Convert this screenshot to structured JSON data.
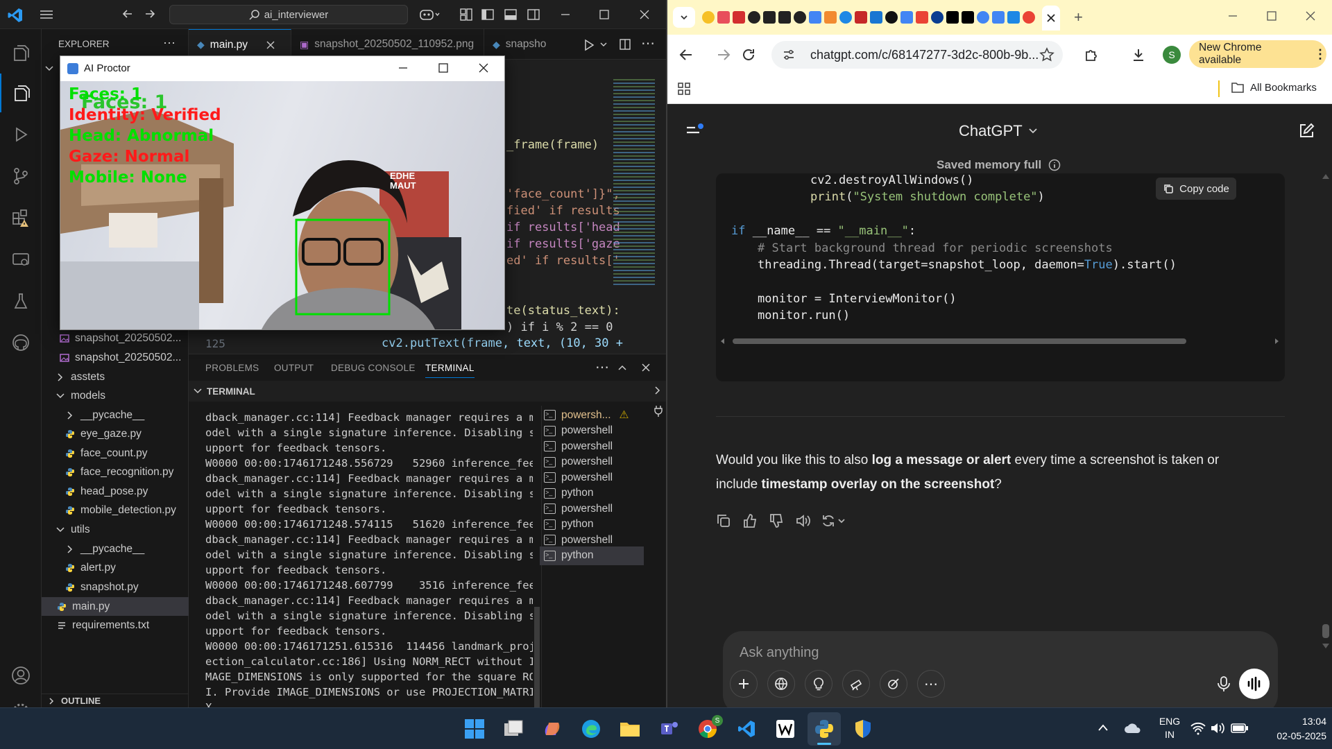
{
  "vscode": {
    "search_text": "ai_interviewer",
    "explorer_title": "EXPLORER",
    "tabs": [
      {
        "label": "main.py"
      },
      {
        "label": "snapshot_20250502_110952.png"
      },
      {
        "label": "snapsho"
      }
    ],
    "tree": [
      {
        "label": "snapshot_20250502...",
        "kind": "image"
      },
      {
        "label": "snapshot_20250502...",
        "kind": "image"
      },
      {
        "label": "asstets",
        "kind": "folder"
      },
      {
        "label": "models",
        "kind": "folder-open"
      },
      {
        "label": "__pycache__",
        "kind": "folder"
      },
      {
        "label": "eye_gaze.py",
        "kind": "py"
      },
      {
        "label": "face_count.py",
        "kind": "py"
      },
      {
        "label": "face_recognition.py",
        "kind": "py"
      },
      {
        "label": "head_pose.py",
        "kind": "py"
      },
      {
        "label": "mobile_detection.py",
        "kind": "py"
      },
      {
        "label": "utils",
        "kind": "folder-open"
      },
      {
        "label": "__pycache__",
        "kind": "folder"
      },
      {
        "label": "alert.py",
        "kind": "py"
      },
      {
        "label": "snapshot.py",
        "kind": "py"
      },
      {
        "label": "main.py",
        "kind": "py"
      },
      {
        "label": "requirements.txt",
        "kind": "txt"
      }
    ],
    "outline_label": "OUTLINE",
    "code_visible": [
      "_frame(frame)",
      "'face_count']}\",",
      "fied' if results",
      "if results['head",
      "if results['gaze",
      "ed' if results['",
      "te(status_text):",
      ") if i % 2 == 0",
      "cv2.putText(frame, text, (10, 30 +"
    ],
    "line_number": "125",
    "panel_tabs": [
      "PROBLEMS",
      "OUTPUT",
      "DEBUG CONSOLE",
      "TERMINAL"
    ],
    "terminal_header": "TERMINAL",
    "terminal_lines": [
      "dback_manager.cc:114] Feedback manager requires a m",
      "odel with a single signature inference. Disabling s",
      "upport for feedback tensors.",
      "W0000 00:00:1746171248.556729   52960 inference_fee",
      "dback_manager.cc:114] Feedback manager requires a m",
      "odel with a single signature inference. Disabling s",
      "upport for feedback tensors.",
      "W0000 00:00:1746171248.574115   51620 inference_fee",
      "dback_manager.cc:114] Feedback manager requires a m",
      "odel with a single signature inference. Disabling s",
      "upport for feedback tensors.",
      "W0000 00:00:1746171248.607799    3516 inference_fee",
      "dback_manager.cc:114] Feedback manager requires a m",
      "odel with a single signature inference. Disabling s",
      "upport for feedback tensors.",
      "W0000 00:00:1746171251.615316  114456 landmark_proj",
      "ection_calculator.cc:186] Using NORM_RECT without I",
      "MAGE_DIMENSIONS is only supported for the square RO",
      "I. Provide IMAGE_DIMENSIONS or use PROJECTION_MATRI",
      "X."
    ],
    "terminals": [
      "powersh...",
      "powershell",
      "powershell",
      "powershell",
      "powershell",
      "python",
      "powershell",
      "python",
      "powershell",
      "python"
    ]
  },
  "proctor": {
    "title": "AI Proctor",
    "faces_ghost": "Faces: 1",
    "faces": "Faces: 1",
    "identity": "Identity: Verified",
    "head": "Head: Abnormal",
    "gaze": "Gaze: Normal",
    "mobile": "Mobile: None",
    "poster_text": "EDHE\nMAUT"
  },
  "chrome": {
    "url": "chatgpt.com/c/68147277-3d2c-800b-9b...",
    "profile_initial": "S",
    "update_label": "New Chrome available",
    "bookmarks_label": "All Bookmarks"
  },
  "chatgpt": {
    "title": "ChatGPT",
    "memory_notice": "Saved memory full",
    "copy_code": "Copy code",
    "code": {
      "l1": "cv2.destroyAllWindows()",
      "l2_fn": "print",
      "l2_str": "\"System shutdown complete\"",
      "l3_kw": "if",
      "l3_a": " __name__ == ",
      "l3_str": "\"__main__\"",
      "l3_b": ":",
      "l4": "# Start background thread for periodic screenshots",
      "l5_a": "threading.Thread(target=snapshot_loop, daemon=",
      "l5_kw": "True",
      "l5_b": ").start()",
      "l6": "monitor = InterviewMonitor()",
      "l7": "monitor.run()"
    },
    "message": {
      "p1": "Would you like this to also ",
      "b1": "log a message or alert",
      "p2": " every time a screenshot is taken or",
      "p3": "include ",
      "b2": "timestamp overlay on the screenshot",
      "p4": "?"
    },
    "composer_placeholder": "Ask anything"
  },
  "taskbar": {
    "lang1": "ENG",
    "lang2": "IN",
    "time": "13:04",
    "date": "02-05-2025",
    "chrome_badge": "S"
  },
  "colors": {
    "terminal_green": "#00e000",
    "overlay_red": "#ff1a1a",
    "code_blue": "#569cd6",
    "code_string": "#ce9178",
    "chrome_update": "#fde293"
  }
}
